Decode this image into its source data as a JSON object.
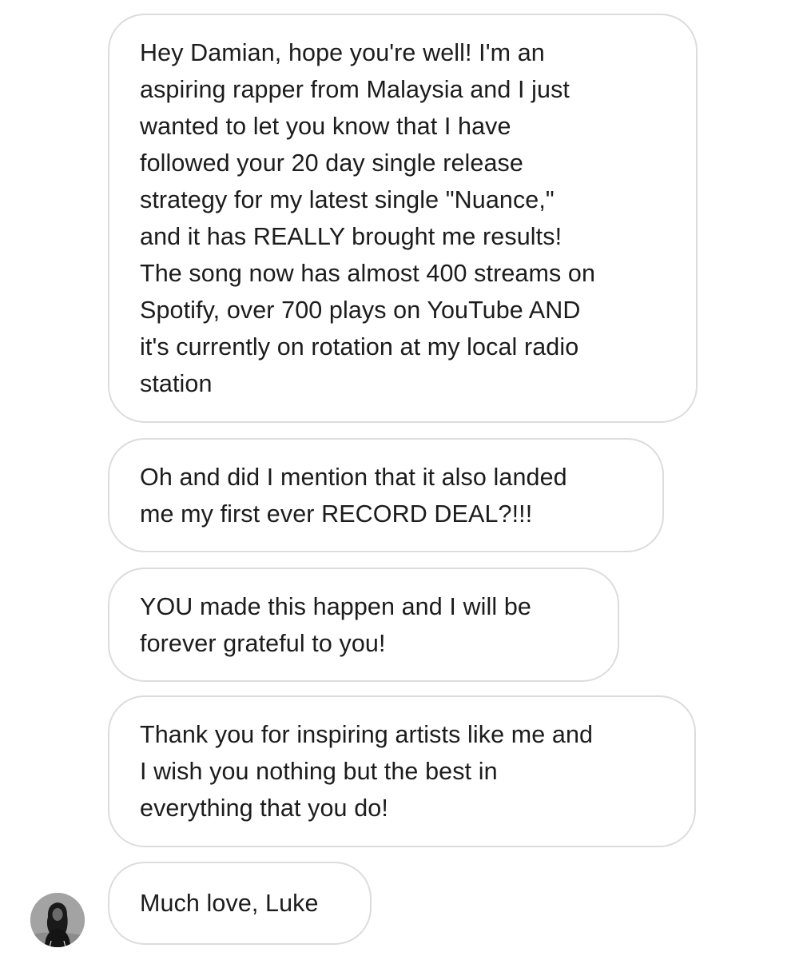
{
  "conversation": {
    "messages": [
      {
        "lines": [
          "Hey Damian, hope you're well! I'm an",
          "aspiring rapper from Malaysia and I just",
          "wanted to let you know that I have",
          "followed your 20 day single release",
          "strategy for my latest single \"Nuance,\"",
          "and it has REALLY brought me results!",
          "The song now has almost 400 streams on",
          "Spotify, over 700 plays on YouTube AND",
          "it's currently on rotation at my local radio",
          "station"
        ]
      },
      {
        "lines": [
          "Oh and did I mention that it also landed",
          "me my first ever RECORD DEAL?!!!"
        ]
      },
      {
        "lines": [
          "YOU made this happen and I will be",
          "forever grateful to you!"
        ]
      },
      {
        "lines": [
          "Thank you for inspiring artists like me and",
          "I wish you nothing but the best in",
          "everything that you do!"
        ]
      },
      {
        "lines": [
          "Much love, Luke"
        ]
      }
    ],
    "sender_avatar_icon": "profile-photo-avatar"
  },
  "colors": {
    "bubble_border": "#dcdcdc",
    "text": "#1c1c1c",
    "background": "#ffffff"
  }
}
